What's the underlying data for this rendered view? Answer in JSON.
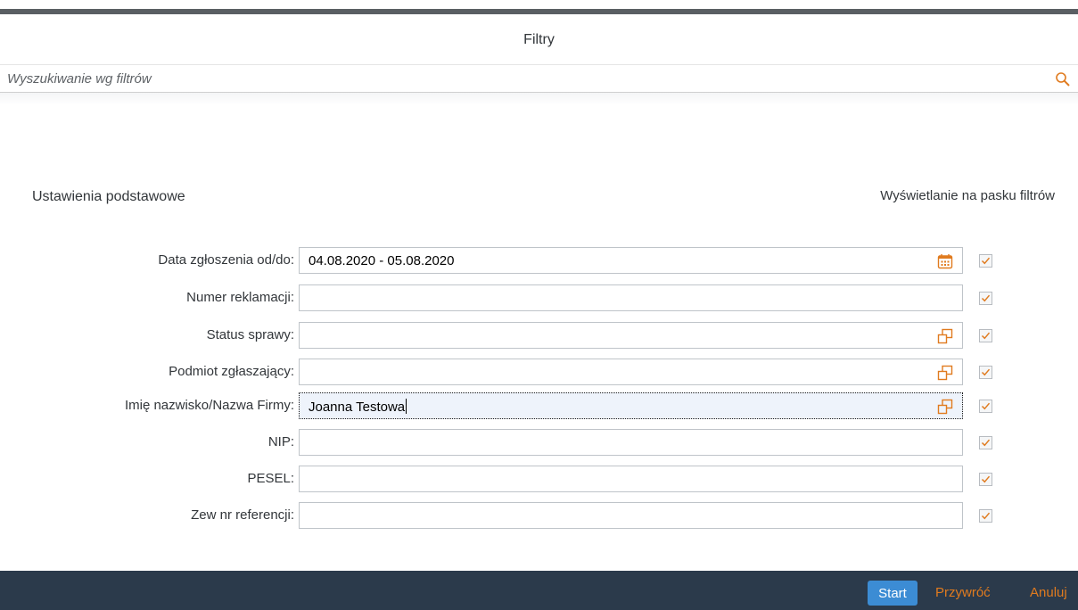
{
  "dialog": {
    "title": "Filtry"
  },
  "search": {
    "placeholder": "Wyszukiwanie wg filtrów",
    "icon": "search-icon"
  },
  "section": {
    "title": "Ustawienia podstawowe",
    "display_column_title": "Wyświetlanie na pasku filtrów"
  },
  "filters": [
    {
      "label": "Data zgłoszenia od/do:",
      "value": "04.08.2020 - 05.08.2020",
      "icon": "calendar-icon",
      "checked": true
    },
    {
      "label": "Numer reklamacji:",
      "value": "",
      "icon": "",
      "checked": true
    },
    {
      "label": "Status sprawy:",
      "value": "",
      "icon": "value-help-icon",
      "checked": true
    },
    {
      "label": "Podmiot zgłaszający:",
      "value": "",
      "icon": "value-help-icon",
      "checked": true
    },
    {
      "label": "Imię nazwisko/Nazwa Firmy:",
      "value": "Joanna Testowa",
      "icon": "value-help-icon",
      "checked": true
    },
    {
      "label": "NIP:",
      "value": "",
      "icon": "",
      "checked": true
    },
    {
      "label": "PESEL:",
      "value": "",
      "icon": "",
      "checked": true
    },
    {
      "label": "Zew nr referencji:",
      "value": "",
      "icon": "",
      "checked": true
    }
  ],
  "footer": {
    "start_label": "Start",
    "restore_label": "Przywróć",
    "cancel_label": "Anuluj"
  },
  "colors": {
    "accent": "#e07b1f",
    "primary_button": "#3c8cd4",
    "footer_bg": "#2b3a4b",
    "focus_bg": "#eef3fb"
  }
}
